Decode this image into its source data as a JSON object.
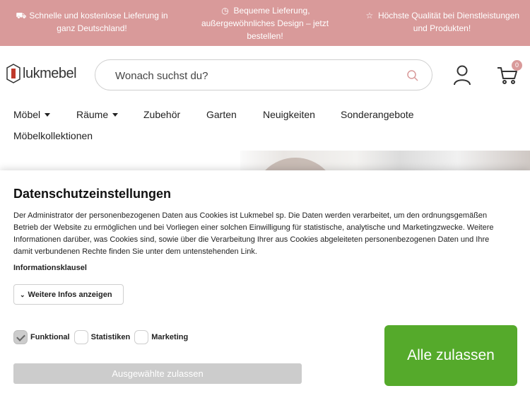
{
  "topbar": {
    "item1": {
      "icon": "truck-icon",
      "text": "Schnelle und kostenlose Lieferung in ganz Deutschland!"
    },
    "item2": {
      "icon": "clock-icon",
      "text": "Bequeme Lieferung, außergewöhnliches Design – jetzt bestellen!"
    },
    "item3": {
      "icon": "star-icon",
      "text": "Höchste Qualität bei Dienstleistungen und Produkten!"
    },
    "background": "#d99a9a"
  },
  "header": {
    "logo_text": "lukmebel",
    "search_placeholder": "Wonach suchst du?",
    "cart_count": "0"
  },
  "nav": {
    "items": [
      "Möbel",
      "Räume",
      "Zubehör",
      "Garten",
      "Neuigkeiten",
      "Sonderangebote",
      "Möbelkollektionen"
    ]
  },
  "cookie": {
    "title": "Datenschutzeinstellungen",
    "description": "Der Administrator der personenbezogenen Daten aus Cookies ist Lukmebel sp. Die Daten werden verarbeitet, um den ordnungsgemäßen Betrieb der Website zu ermöglichen und bei Vorliegen einer solchen Einwilligung für statistische, analytische und Marketingzwecke. Weitere Informationen darüber, was Cookies sind, sowie über die Verarbeitung Ihrer aus Cookies abgeleiteten personenbezogenen Daten und Ihre damit verbundenen Rechte finden Sie unter dem untenstehenden Link.",
    "info_link": "Informationsklausel",
    "more_button": "Weitere Infos anzeigen",
    "options": [
      {
        "label": "Funktional",
        "checked": true
      },
      {
        "label": "Statistiken",
        "checked": false
      },
      {
        "label": "Marketing",
        "checked": false
      }
    ],
    "selected_button": "Ausgewählte zulassen",
    "allow_all_button": "Alle zulassen",
    "accent_color": "#55aa2b"
  }
}
